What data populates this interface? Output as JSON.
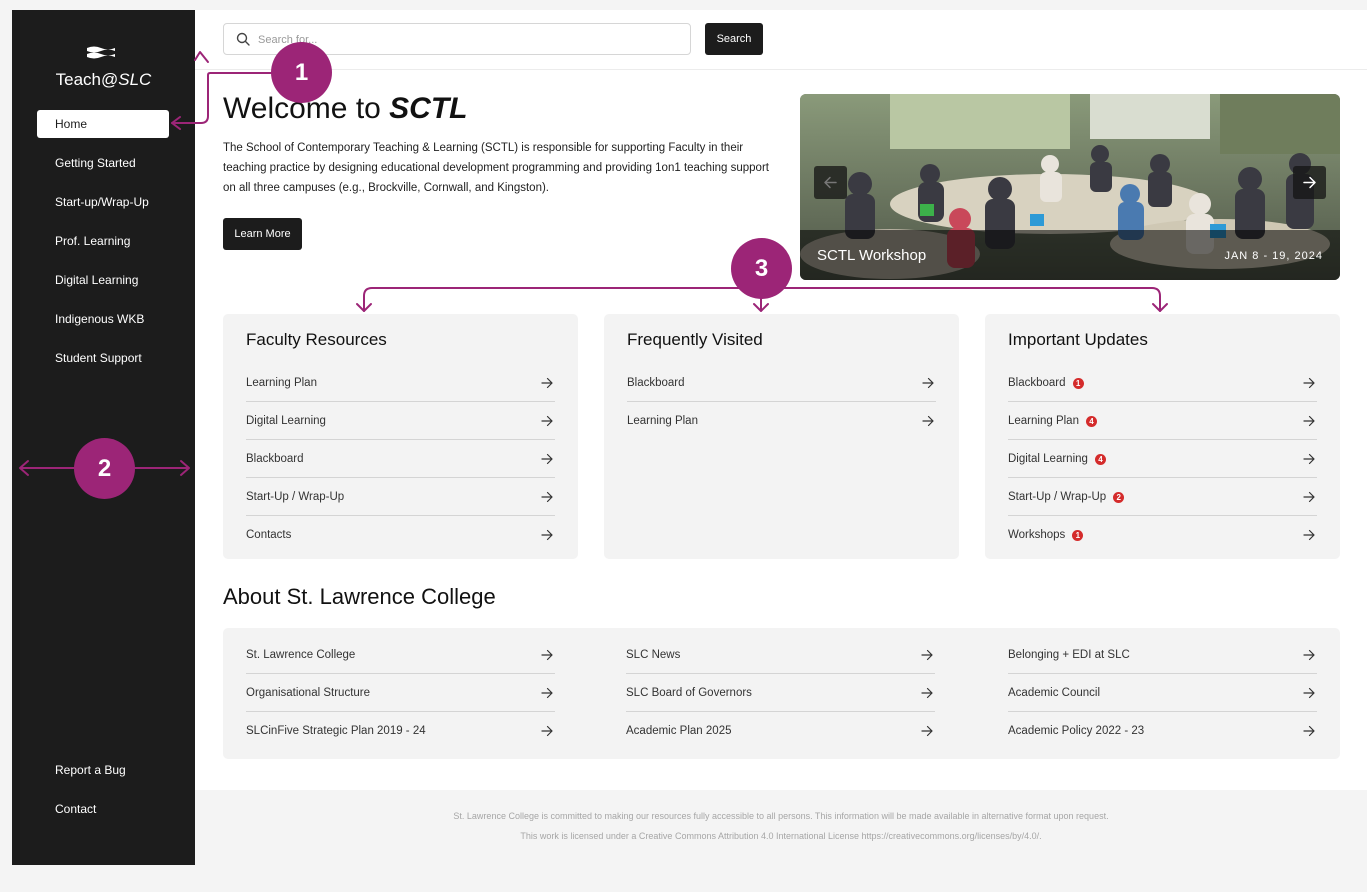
{
  "app": {
    "logo_text": "Teach@",
    "logo_text_em": "SLC"
  },
  "sidebar": {
    "items": [
      {
        "label": "Home",
        "active": true
      },
      {
        "label": "Getting Started"
      },
      {
        "label": "Start-up/Wrap-Up"
      },
      {
        "label": "Prof. Learning"
      },
      {
        "label": "Digital Learning"
      },
      {
        "label": "Indigenous WKB"
      },
      {
        "label": "Student Support"
      }
    ],
    "bottom_items": [
      {
        "label": "Report a Bug"
      },
      {
        "label": "Contact"
      }
    ]
  },
  "search": {
    "placeholder": "Search for...",
    "value": "",
    "button_label": "Search"
  },
  "hero": {
    "title_prefix": "Welcome to ",
    "title_em": "SCTL",
    "description": "The School of Contemporary Teaching & Learning (SCTL) is responsible for supporting Faculty in their teaching practice by designing educational development programming and providing 1on1 teaching support on all three campuses (e.g., Brockville, Cornwall, and Kingston).",
    "button_label": "Learn More"
  },
  "carousel": {
    "title": "SCTL Workshop",
    "date": "JAN 8 - 19, 2024"
  },
  "cards": [
    {
      "title": "Faculty Resources",
      "links": [
        {
          "label": "Learning Plan"
        },
        {
          "label": "Digital Learning"
        },
        {
          "label": "Blackboard"
        },
        {
          "label": "Start-Up / Wrap-Up"
        },
        {
          "label": "Contacts"
        }
      ]
    },
    {
      "title": "Frequently Visited",
      "links": [
        {
          "label": "Blackboard"
        },
        {
          "label": "Learning Plan"
        }
      ]
    },
    {
      "title": "Important Updates",
      "links": [
        {
          "label": "Blackboard",
          "badge": "1"
        },
        {
          "label": "Learning Plan",
          "badge": "4"
        },
        {
          "label": "Digital Learning",
          "badge": "4"
        },
        {
          "label": "Start-Up / Wrap-Up",
          "badge": "2"
        },
        {
          "label": "Workshops",
          "badge": "1"
        }
      ]
    }
  ],
  "about": {
    "title": "About St. Lawrence College",
    "columns": [
      [
        {
          "label": "St. Lawrence College"
        },
        {
          "label": "Organisational Structure"
        },
        {
          "label": "SLCinFive Strategic Plan 2019 - 24"
        }
      ],
      [
        {
          "label": "SLC News"
        },
        {
          "label": "SLC Board of Governors"
        },
        {
          "label": "Academic Plan 2025"
        }
      ],
      [
        {
          "label": "Belonging + EDI at SLC"
        },
        {
          "label": "Academic Council"
        },
        {
          "label": "Academic Policy 2022 - 23"
        }
      ]
    ]
  },
  "footer": {
    "line1": "St. Lawrence College is committed to making our resources fully accessible to all persons.  This information will be made available in alternative format upon request.",
    "line2": "This work is licensed under a Creative Commons Attribution 4.0 International License https://creativecommons.org/licenses/by/4.0/."
  },
  "annotations": [
    {
      "label": "1"
    },
    {
      "label": "2"
    },
    {
      "label": "3"
    }
  ],
  "colors": {
    "sidebar_bg": "#1c1c1c",
    "annotation": "#9c2577",
    "badge": "#d42b2b",
    "card_bg": "#f3f3f3"
  }
}
